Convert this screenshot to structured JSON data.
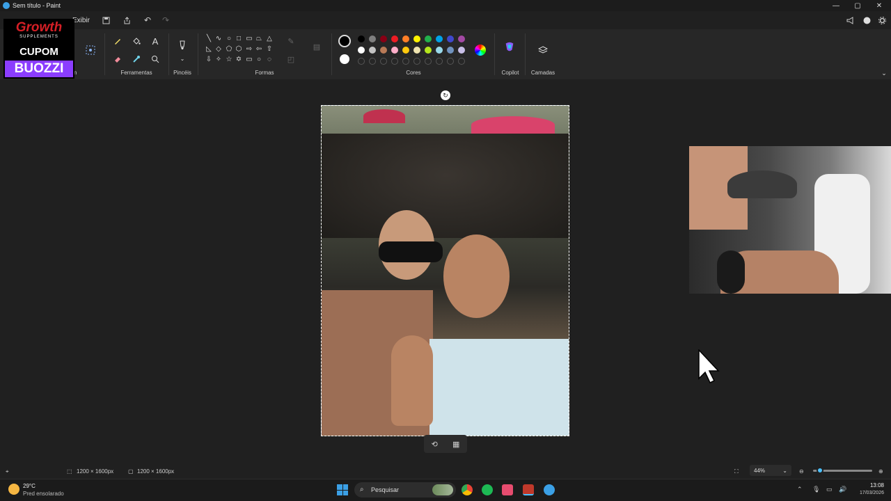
{
  "window": {
    "title": "Sem título - Paint"
  },
  "menu": {
    "view_label": "Exibir",
    "partial_label": "m"
  },
  "ribbon": {
    "groups": {
      "tools": "Ferramentas",
      "brushes": "Pincéis",
      "shapes": "Formas",
      "colors": "Cores",
      "copilot": "Copilot",
      "layers": "Camadas"
    },
    "palette_row1": [
      "#000000",
      "#7f7f7f",
      "#880015",
      "#ed1c24",
      "#ff7f27",
      "#fff200",
      "#22b14c",
      "#00a2e8",
      "#3f48cc",
      "#a349a4"
    ],
    "palette_row2": [
      "#ffffff",
      "#c3c3c3",
      "#b97a57",
      "#ffaec9",
      "#ffc90e",
      "#efe4b0",
      "#b5e61d",
      "#99d9ea",
      "#7092be",
      "#c8bfe7"
    ],
    "primary_color": "#000000",
    "secondary_color": "#ffffff"
  },
  "promo": {
    "brand": "Growth",
    "brand_sub": "SUPPLEMENTS",
    "coupon_label": "CUPOM",
    "coupon_code": "BUOZZI"
  },
  "status": {
    "selection_size": "1200 × 1600px",
    "canvas_size": "1200 × 1600px",
    "zoom": "44%",
    "zoom_fraction": 0.06
  },
  "taskbar": {
    "weather_temp": "29°C",
    "weather_desc": "Pred ensolarado",
    "search_placeholder": "Pesquisar",
    "time": "13:08",
    "date": "17/03/2026"
  },
  "icons": {
    "minimize": "—",
    "maximize": "▢",
    "close": "✕",
    "save": "💾",
    "share": "⇪",
    "undo": "↶",
    "redo": "↷"
  }
}
